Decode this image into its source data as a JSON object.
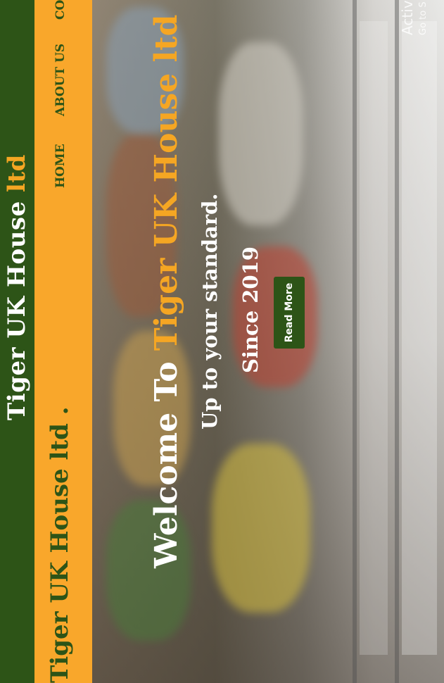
{
  "topbar": {
    "brand_main": "Tiger UK House ",
    "brand_accent": "ltd"
  },
  "navbar": {
    "brand": "Tiger UK House ltd",
    "brand_dot": " .",
    "items": [
      {
        "label": "HOME"
      },
      {
        "label": "ABOUT US"
      },
      {
        "label": "CO"
      }
    ]
  },
  "hero": {
    "title_prefix": "Welcome To ",
    "title_accent": "Tiger UK House ltd",
    "subtitle": "Up to your standard.",
    "since": "Since 2019",
    "button_label": "Read More"
  },
  "overlay": {
    "activate": "Activa",
    "activate_sub": "Go to S"
  },
  "colors": {
    "dark_green": "#2d5417",
    "orange": "#f9a72b",
    "accent": "#f5a623"
  }
}
